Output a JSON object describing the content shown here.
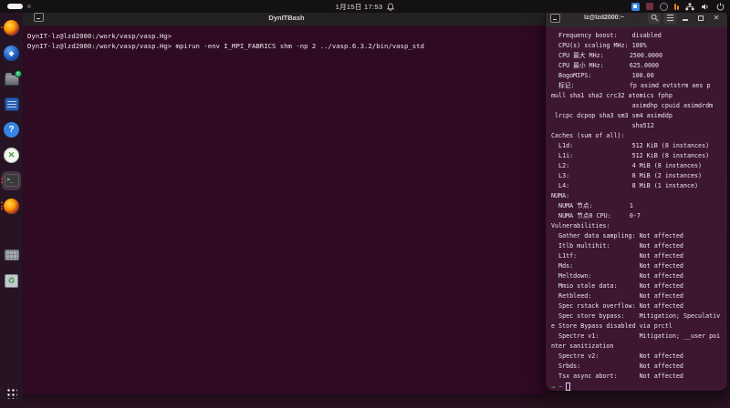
{
  "topbar": {
    "clock": "1月15日 17:53",
    "workspace_indicator": "active-pill",
    "tray_icons": [
      "input-method-icon",
      "recording-icon",
      "screencast-icon",
      "mic-level-icon",
      "network-icon",
      "volume-icon",
      "power-icon"
    ]
  },
  "dock": {
    "items": [
      "firefox",
      "blue-gem-app",
      "file-manager",
      "blue-text-app",
      "help",
      "x-session-app",
      "terminal-active",
      "firefox-running",
      "keyboard-app",
      "trash",
      "app-grid"
    ]
  },
  "main_window": {
    "title": "DynITBash",
    "terminal_lines": [
      "DynIT-lz@lzd2000:/work/vasp/vasp.Hg>",
      "DynIT-lz@lzd2000:/work/vasp/vasp.Hg> mpirun -env I_MPI_FABRICS shm -np 2 ../vasp.6.3.2/bin/vasp_std"
    ]
  },
  "right_window": {
    "title": "lz@lzd2000:~",
    "terminal_lines": [
      "  Frequency boost:    disabled",
      "  CPU(s) scaling MHz: 100%",
      "  CPU 最大 MHz:       2500.0000",
      "  CPU 最小 MHz:       625.0000",
      "  BogoMIPS:           100.00",
      "  标记:               fp asimd evtstrm aes p",
      "mull sha1 sha2 crc32 atomics fphp",
      "                      asimdhp cpuid asimdrdm",
      " lrcpc dcpop sha3 sm3 sm4 asimddp",
      "                      sha512",
      "Caches (sum of all):",
      "  L1d:                512 KiB (8 instances)",
      "  L1i:                512 KiB (8 instances)",
      "  L2:                 4 MiB (8 instances)",
      "  L3:                 8 MiB (2 instances)",
      "  L4:                 8 MiB (1 instance)",
      "NUMA:",
      "  NUMA 节点:          1",
      "  NUMA 节点0 CPU:     0-7",
      "Vulnerabilities:",
      "  Gather data sampling: Not affected",
      "  Itlb multihit:        Not affected",
      "  L1tf:                 Not affected",
      "  Mds:                  Not affected",
      "  Meltdown:             Not affected",
      "  Mmio stale data:      Not affected",
      "  Retbleed:             Not affected",
      "  Spec rstack overflow: Not affected",
      "  Spec store bypass:    Mitigation; Speculativ",
      "e Store Bypass disabled via prctl",
      "  Spectre v1:           Mitigation; __user poi",
      "nter sanitization",
      "  Spectre v2:           Not affected",
      "  Srbds:                Not affected",
      "  Tsx async abort:      Not affected"
    ],
    "prompt": {
      "arrow": "→",
      "path": "~"
    }
  },
  "colors": {
    "main_terminal_bg": "#2e0a23",
    "right_terminal_bg": "#3d1631",
    "titlebar_bg": "#2d292c",
    "topbar_bg": "#141114",
    "prompt_arrow": "#3fd23f",
    "prompt_path": "#35b5c9",
    "running_dot": "#e0431f",
    "badge_green": "#2ec27e"
  }
}
